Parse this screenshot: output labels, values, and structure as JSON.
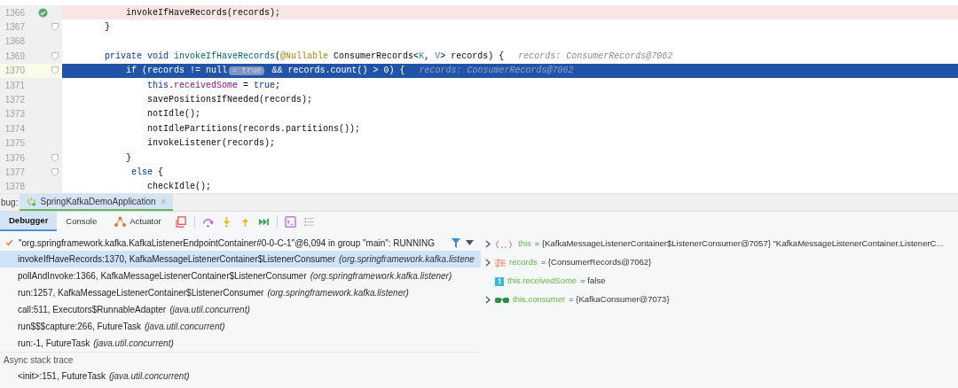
{
  "editor": {
    "lines": [
      {
        "number": "1366",
        "kind": "executed",
        "gutter_icon": {
          "kind": "check"
        },
        "segments": [
          {
            "text": "            invokeIfHaveRecords(records);",
            "kind": "plain"
          }
        ]
      },
      {
        "number": "1367",
        "kind": "normal",
        "gutter_icon": {
          "kind": "fold"
        },
        "segments": [
          {
            "text": "        }",
            "kind": "plain"
          }
        ]
      },
      {
        "number": "1368",
        "kind": "normal"
      },
      {
        "number": "1369",
        "kind": "normal",
        "gutter_icon": {
          "kind": "fold"
        },
        "segments": [
          {
            "text": "        private",
            "kind": "keyword"
          },
          {
            "text": " void",
            "kind": "keyword"
          },
          {
            "text": " invokeIfHaveRecords",
            "kind": "method"
          },
          {
            "text": "(",
            "kind": "plain"
          },
          {
            "text": "@Nullable",
            "kind": "annotation"
          },
          {
            "text": " ConsumerRecords<",
            "kind": "plain"
          },
          {
            "text": "K",
            "kind": "type_param"
          },
          {
            "text": ", ",
            "kind": "plain"
          },
          {
            "text": "V",
            "kind": "type_param"
          },
          {
            "text": "> records) {",
            "kind": "plain"
          },
          {
            "text": "records: ConsumerRecords@7062",
            "kind": "end_hint"
          }
        ]
      },
      {
        "number": "1370",
        "kind": "current",
        "gutter_icon": {
          "kind": "fold"
        },
        "segments": [
          {
            "text": "            if (records != null",
            "kind": "plain"
          },
          {
            "text": "= true",
            "kind": "inline_hint"
          },
          {
            "text": " && records.count() > 0) {",
            "kind": "plain"
          },
          {
            "text": "records: ConsumerRecords@7062",
            "kind": "end_hint"
          }
        ]
      },
      {
        "number": "1371",
        "kind": "normal",
        "segments": [
          {
            "text": "                this",
            "kind": "keyword"
          },
          {
            "text": ".",
            "kind": "plain"
          },
          {
            "text": "receivedSome",
            "kind": "field"
          },
          {
            "text": " = ",
            "kind": "plain"
          },
          {
            "text": "true",
            "kind": "keyword"
          },
          {
            "text": ";",
            "kind": "plain"
          }
        ]
      },
      {
        "number": "1372",
        "kind": "normal",
        "segments": [
          {
            "text": "                savePositionsIfNeeded(records);",
            "kind": "plain"
          }
        ]
      },
      {
        "number": "1373",
        "kind": "normal",
        "segments": [
          {
            "text": "                notIdle();",
            "kind": "plain"
          }
        ]
      },
      {
        "number": "1374",
        "kind": "normal",
        "segments": [
          {
            "text": "                notIdlePartitions(records.partitions());",
            "kind": "plain"
          }
        ]
      },
      {
        "number": "1375",
        "kind": "normal",
        "segments": [
          {
            "text": "                invokeListener(records);",
            "kind": "plain"
          }
        ]
      },
      {
        "number": "1376",
        "kind": "normal",
        "gutter_icon": {
          "kind": "fold"
        },
        "segments": [
          {
            "text": "            }",
            "kind": "plain"
          }
        ]
      },
      {
        "number": "1377",
        "kind": "normal",
        "gutter_icon": {
          "kind": "fold"
        },
        "segments": [
          {
            "text": "             else",
            "kind": "keyword"
          },
          {
            "text": " {",
            "kind": "plain"
          }
        ]
      },
      {
        "number": "1378",
        "kind": "normal",
        "segments": [
          {
            "text": "                checkIdle();",
            "kind": "plain"
          }
        ]
      }
    ]
  },
  "debug": {
    "label": "bug:",
    "run_tabs": [
      {
        "label": "SpringKafkaDemoApplication",
        "selected": true,
        "close": "×"
      }
    ],
    "tabs": [
      {
        "label": "Debugger",
        "selected": true,
        "kind": "text"
      },
      {
        "label": "Console",
        "selected": false,
        "kind": "text"
      },
      {
        "label": "Actuator",
        "selected": false,
        "kind": "actuator"
      }
    ],
    "toolbar": [
      {
        "kind": "stop-frames"
      },
      {
        "kind": "step-over"
      },
      {
        "kind": "step-into"
      },
      {
        "kind": "step-out"
      },
      {
        "kind": "run-to-cursor"
      },
      {
        "kind": "evaluate"
      },
      {
        "kind": "list"
      }
    ],
    "thread": "\"org.springframework.kafka.KafkaListenerEndpointContainer#0-0-C-1\"@6,094 in group \"main\": RUNNING",
    "frames": [
      {
        "method": "invokeIfHaveRecords:1370, KafkaMessageListenerContainer$ListenerConsumer",
        "package": "(org.springframework.kafka.listene",
        "selected": true
      },
      {
        "method": "pollAndInvoke:1366, KafkaMessageListenerContainer$ListenerConsumer",
        "package": "(org.springframework.kafka.listener)",
        "selected": false
      },
      {
        "method": "run:1257, KafkaMessageListenerContainer$ListenerConsumer",
        "package": "(org.springframework.kafka.listener)",
        "selected": false
      },
      {
        "method": "call:511, Executors$RunnableAdapter",
        "package": "(java.util.concurrent)",
        "selected": false
      },
      {
        "method": "run$$$capture:266, FutureTask",
        "package": "(java.util.concurrent)",
        "selected": false
      },
      {
        "method": "run:-1, FutureTask",
        "package": "(java.util.concurrent)",
        "selected": false
      }
    ],
    "async_label": "Async stack trace",
    "async_frames": [
      {
        "method": "<init>:151, FutureTask",
        "package": "(java.util.concurrent)",
        "selected": false
      }
    ],
    "variables": [
      {
        "kind": "object",
        "expandable": true,
        "name": "this",
        "value": "= {KafkaMessageListenerContainer$ListenerConsumer@7057} \"KafkaMessageListenerContainer.ListenerC..."
      },
      {
        "kind": "parameter",
        "expandable": true,
        "name": "records",
        "value": "= {ConsumerRecords@7062}"
      },
      {
        "kind": "primitive",
        "expandable": false,
        "name": "this.receivedSome",
        "value": "= false"
      },
      {
        "kind": "watch",
        "expandable": true,
        "name": "this.consumer",
        "value": "= {KafkaConsumer@7073}"
      }
    ]
  }
}
